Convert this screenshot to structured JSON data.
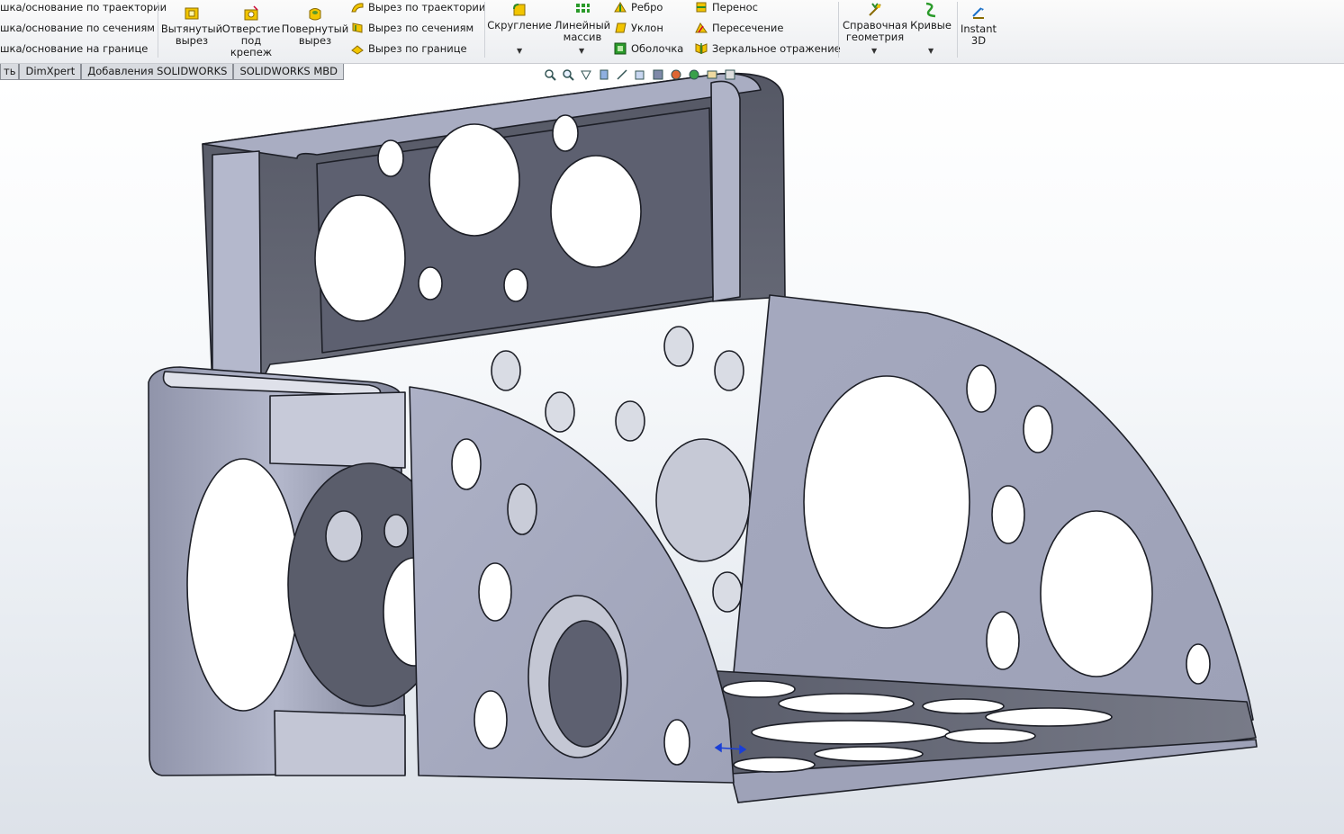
{
  "ribbon": {
    "left_group": [
      "шка/основание по траектории",
      "шка/основание по сечениям",
      "шка/основание на границе"
    ],
    "extruded_cut": "Вытянутый\nвырез",
    "hole_wizard": "Отверстие\nпод\nкрепеж",
    "revolved_cut": "Повернутый\nвырез",
    "cut_group": [
      "Вырез по траектории",
      "Вырез по сечениям",
      "Вырез по границе"
    ],
    "fillet": "Скругление",
    "linear_pattern": "Линейный\nмассив",
    "rib_group": [
      "Ребро",
      "Уклон",
      "Оболочка"
    ],
    "move_group": [
      "Перенос",
      "Пересечение",
      "Зеркальное отражение"
    ],
    "ref_geometry": "Справочная\nгеометрия",
    "curves": "Кривые",
    "instant3d": "Instant\n3D"
  },
  "tabs": [
    "ть",
    "DimXpert",
    "Добавления SOLIDWORKS",
    "SOLIDWORKS MBD"
  ],
  "colors": {
    "part_face": "#a3a8bd",
    "part_dark": "#5e6171",
    "part_edge": "#1d1f27",
    "accent": "#1a3fd6"
  }
}
